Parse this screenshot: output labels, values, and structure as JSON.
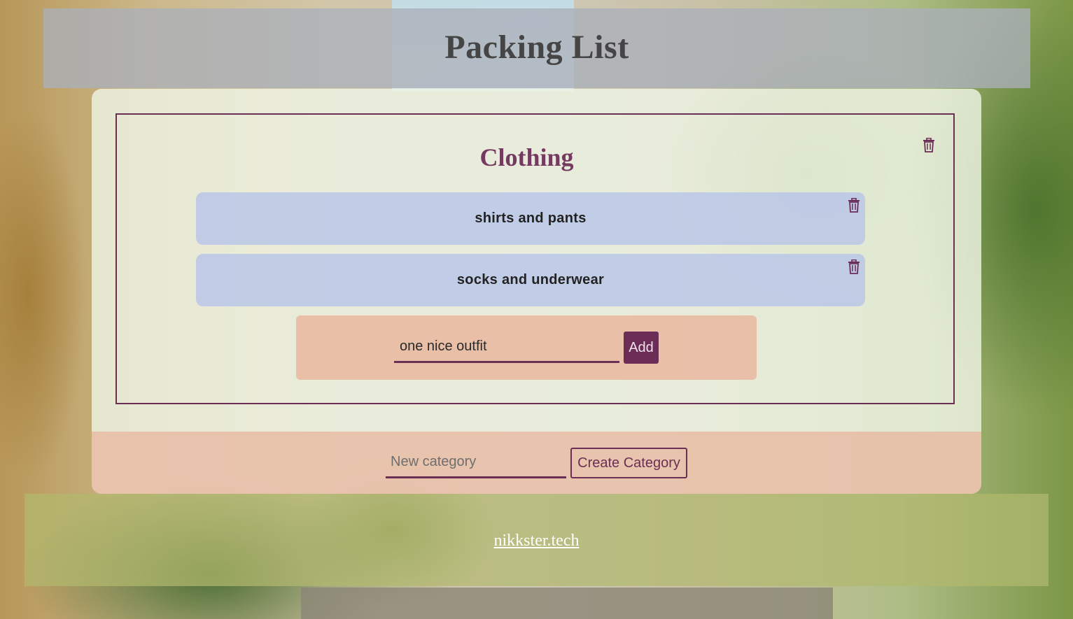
{
  "page": {
    "title": "Packing List"
  },
  "category": {
    "title": "Clothing",
    "delete_icon": "trash-icon",
    "items": [
      {
        "label": "shirts and pants",
        "delete_icon": "trash-icon"
      },
      {
        "label": "socks and underwear",
        "delete_icon": "trash-icon"
      }
    ],
    "add_item": {
      "value": "one nice outfit",
      "button_label": "Add"
    }
  },
  "new_category": {
    "placeholder": "New category",
    "value": "",
    "button_label": "Create Category"
  },
  "footer": {
    "link_text": "nikkster.tech"
  },
  "colors": {
    "accent": "#6b2c56",
    "category_title": "#743a60",
    "item_background": "#b8c5e8",
    "add_box_background": "#e8b8a0"
  }
}
